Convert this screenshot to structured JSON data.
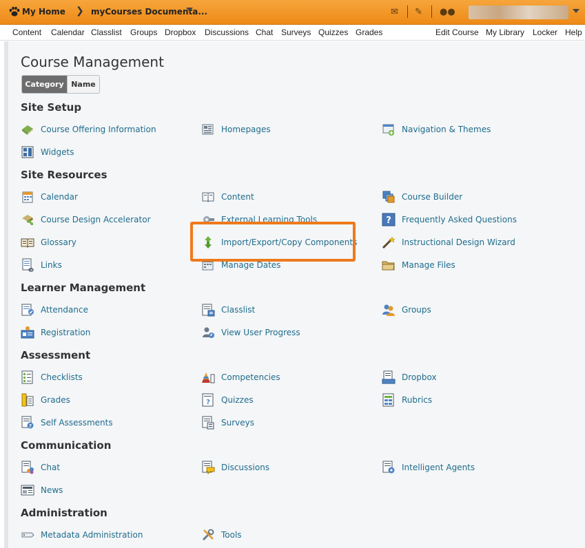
{
  "topbar": {
    "home_label": "My Home",
    "course_label": "myCourses Documenta..."
  },
  "nav": {
    "left": [
      "Content",
      "Calendar",
      "Classlist",
      "Groups",
      "Dropbox",
      "Discussions",
      "Chat",
      "Surveys",
      "Quizzes",
      "Grades"
    ],
    "right": [
      "Edit Course",
      "My Library",
      "Locker",
      "Help"
    ]
  },
  "page": {
    "title": "Course Management",
    "toggle": {
      "category": "Category",
      "name": "Name"
    }
  },
  "sections": [
    {
      "heading": "Site Setup",
      "items": [
        {
          "label": "Course Offering Information",
          "icon": "book-icon"
        },
        {
          "label": "Homepages",
          "icon": "homepage-icon"
        },
        {
          "label": "Navigation & Themes",
          "icon": "navigation-icon"
        },
        {
          "label": "Widgets",
          "icon": "widget-icon"
        }
      ]
    },
    {
      "heading": "Site Resources",
      "items": [
        {
          "label": "Calendar",
          "icon": "calendar-icon"
        },
        {
          "label": "Content",
          "icon": "content-icon"
        },
        {
          "label": "Course Builder",
          "icon": "course-builder-icon"
        },
        {
          "label": "Course Design Accelerator",
          "icon": "accelerator-icon"
        },
        {
          "label": "External Learning Tools",
          "icon": "external-tools-icon"
        },
        {
          "label": "Frequently Asked Questions",
          "icon": "faq-icon"
        },
        {
          "label": "Glossary",
          "icon": "glossary-icon"
        },
        {
          "label": "Import/Export/Copy Components",
          "icon": "import-export-icon"
        },
        {
          "label": "Instructional Design Wizard",
          "icon": "wizard-icon"
        },
        {
          "label": "Links",
          "icon": "links-icon"
        },
        {
          "label": "Manage Dates",
          "icon": "manage-dates-icon"
        },
        {
          "label": "Manage Files",
          "icon": "folder-icon"
        }
      ]
    },
    {
      "heading": "Learner Management",
      "items": [
        {
          "label": "Attendance",
          "icon": "attendance-icon"
        },
        {
          "label": "Classlist",
          "icon": "classlist-icon"
        },
        {
          "label": "Groups",
          "icon": "groups-icon"
        },
        {
          "label": "Registration",
          "icon": "registration-icon"
        },
        {
          "label": "View User Progress",
          "icon": "user-progress-icon"
        }
      ]
    },
    {
      "heading": "Assessment",
      "items": [
        {
          "label": "Checklists",
          "icon": "checklist-icon"
        },
        {
          "label": "Competencies",
          "icon": "competencies-icon"
        },
        {
          "label": "Dropbox",
          "icon": "dropbox-icon"
        },
        {
          "label": "Grades",
          "icon": "grades-icon"
        },
        {
          "label": "Quizzes",
          "icon": "quiz-icon"
        },
        {
          "label": "Rubrics",
          "icon": "rubrics-icon"
        },
        {
          "label": "Self Assessments",
          "icon": "self-assessment-icon"
        },
        {
          "label": "Surveys",
          "icon": "survey-icon"
        }
      ]
    },
    {
      "heading": "Communication",
      "items": [
        {
          "label": "Chat",
          "icon": "chat-icon"
        },
        {
          "label": "Discussions",
          "icon": "discussions-icon"
        },
        {
          "label": "Intelligent Agents",
          "icon": "agents-icon"
        },
        {
          "label": "News",
          "icon": "news-icon"
        }
      ]
    },
    {
      "heading": "Administration",
      "items": [
        {
          "label": "Metadata Administration",
          "icon": "metadata-icon"
        },
        {
          "label": "Tools",
          "icon": "tools-icon"
        }
      ]
    }
  ],
  "colors": {
    "topbar": "#f09225",
    "link": "#206c8c",
    "highlight": "#ee7a1d",
    "panel": "#f4f6f8"
  }
}
